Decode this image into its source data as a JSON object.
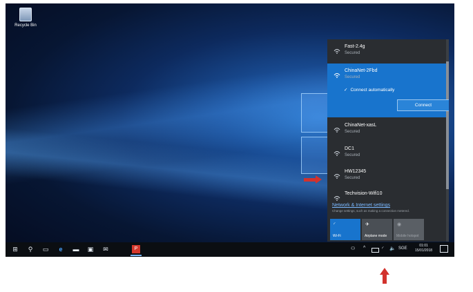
{
  "desktop": {
    "recycle_bin_label": "Recycle Bin"
  },
  "wifi_flyout": {
    "networks": [
      {
        "name": "Fast-2.4g",
        "status": "Secured"
      },
      {
        "name": "ChinaNet-2Fbd",
        "status": "Secured",
        "selected": true,
        "connect_automatically_label": "Connect automatically",
        "connect_button_label": "Connect"
      },
      {
        "name": "ChinaNet-xasL",
        "status": "Secured"
      },
      {
        "name": "DC1",
        "status": "Secured"
      },
      {
        "name": "HW12345",
        "status": "Secured"
      },
      {
        "name": "Techvision-Wifi10",
        "status": ""
      }
    ],
    "settings_link": "Network & Internet settings",
    "settings_sub": "Change settings, such as making a connection metered.",
    "quick_actions": [
      {
        "label": "Wi-Fi",
        "icon": "wifi-icon",
        "active": true
      },
      {
        "label": "Airplane mode",
        "icon": "airplane-icon",
        "active": false
      },
      {
        "label": "Mobile hotspot",
        "icon": "hotspot-icon",
        "active": false
      }
    ]
  },
  "taskbar": {
    "icons": [
      "windows-start-icon",
      "search-icon",
      "task-view-icon",
      "edge-icon",
      "file-explorer-icon",
      "store-icon",
      "mail-icon",
      "app-icon"
    ],
    "tray": {
      "language": "SGE",
      "time": "01:01",
      "date": "15/01/2018"
    }
  },
  "colors": {
    "accent": "#1874cd",
    "flyout_bg": "#2a2d31",
    "annotation_arrow": "#d2322d"
  }
}
